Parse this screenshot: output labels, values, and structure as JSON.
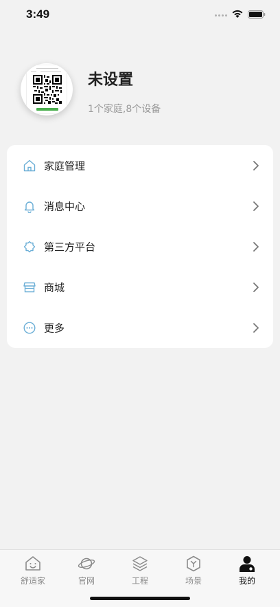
{
  "status_bar": {
    "time": "3:49"
  },
  "profile": {
    "name": "未设置",
    "summary": "1个家庭,8个设备"
  },
  "menu": {
    "items": [
      {
        "label": "家庭管理",
        "icon": "home-icon"
      },
      {
        "label": "消息中心",
        "icon": "bell-icon"
      },
      {
        "label": "第三方平台",
        "icon": "gear-icon"
      },
      {
        "label": "商城",
        "icon": "store-icon"
      },
      {
        "label": "更多",
        "icon": "more-icon"
      }
    ]
  },
  "tab_bar": {
    "tabs": [
      {
        "label": "舒适家",
        "icon": "smile-house-icon"
      },
      {
        "label": "官网",
        "icon": "planet-icon"
      },
      {
        "label": "工程",
        "icon": "layers-icon"
      },
      {
        "label": "场景",
        "icon": "cube-icon"
      },
      {
        "label": "我的",
        "icon": "user-icon"
      }
    ],
    "active": "我的"
  },
  "colors": {
    "background": "#f2f2f2",
    "card": "#ffffff",
    "menu_icon": "#6aaed6",
    "tab_inactive": "#8a8a8a",
    "tab_active": "#111111"
  }
}
